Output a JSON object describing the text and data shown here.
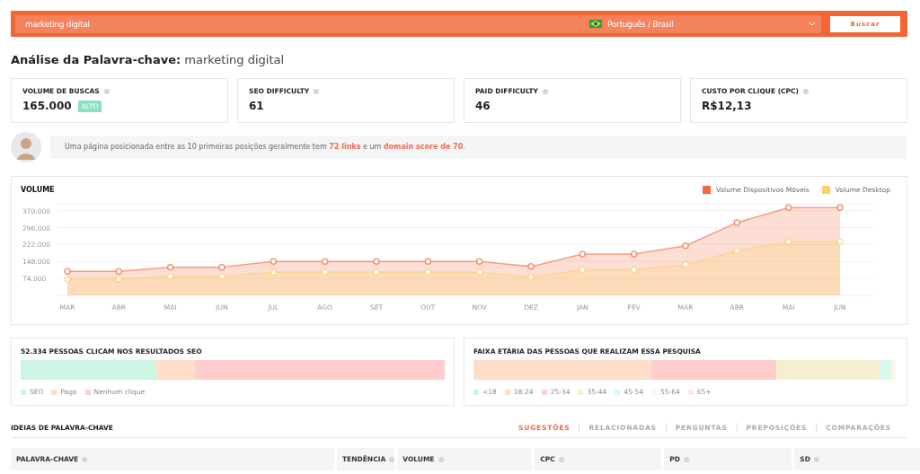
{
  "search": {
    "value": "marketing digital",
    "language": "Português / Brasil",
    "button": "Buscar"
  },
  "heading": {
    "label": "Análise da Palavra-chave:",
    "keyword": "marketing digital"
  },
  "metrics": [
    {
      "label": "VOLUME DE BUSCAS",
      "value": "165.000",
      "badge": "ALTO"
    },
    {
      "label": "SEO DIFFICULTY",
      "value": "61"
    },
    {
      "label": "PAID DIFFICULTY",
      "value": "46"
    },
    {
      "label": "CUSTO POR CLIQUE (CPC)",
      "value": "R$12,13"
    }
  ],
  "tip": "Uma página posicionada entre as 10 primeiras posições geralmente tem **72 links** e um **domain score de 70**.",
  "volume": {
    "title": "VOLUME",
    "chart_data": {
      "type": "area",
      "categories": [
        "MAR",
        "ABR",
        "MAI",
        "JUN",
        "JUL",
        "AGO",
        "SET",
        "OUT",
        "NOV",
        "DEZ",
        "JAN",
        "FEV",
        "MAR",
        "ABR",
        "MAI",
        "JUN"
      ],
      "series": [
        {
          "name": "Volume Dispositivos Móveis",
          "color": "#f26a3c",
          "values": [
            105000,
            105000,
            123000,
            123000,
            148000,
            148000,
            148000,
            148000,
            148000,
            126000,
            180000,
            180000,
            217000,
            318000,
            383000,
            383000
          ]
        },
        {
          "name": "Volume Desktop",
          "color": "#fdd06b",
          "values": [
            72000,
            72000,
            83000,
            83000,
            101000,
            101000,
            101000,
            101000,
            101000,
            79000,
            112000,
            112000,
            134000,
            195000,
            235000,
            235000
          ]
        }
      ],
      "grid": true,
      "ylim": [
        0,
        400000
      ],
      "yticks": [
        {
          "value": 74000,
          "label": "74.000"
        },
        {
          "value": 148000,
          "label": "148.000"
        },
        {
          "value": 222000,
          "label": "222.000"
        },
        {
          "value": 296000,
          "label": "296.000"
        },
        {
          "value": 370000,
          "label": "370.000"
        }
      ]
    }
  },
  "clicks": {
    "title": "52.334 PESSOAS CLICAM NOS RESULTADOS SEO",
    "segments": [
      {
        "label": "SEO",
        "color": "#cdf5e3"
      },
      {
        "label": "Pago",
        "color": "#ffdfc9"
      },
      {
        "label": "Nenhum clique",
        "color": "#ffcdcd"
      }
    ]
  },
  "ages": {
    "title": "FAIXA ETÁRIA DAS PESSOAS QUE REALIZAM ESSA PESQUISA",
    "segments": [
      {
        "label": "<18",
        "color": "#cdf5e3"
      },
      {
        "label": "18-24",
        "color": "#ffdfc9"
      },
      {
        "label": "25-34",
        "color": "#ffcdcd"
      },
      {
        "label": "35-44",
        "color": "#f7eed0"
      },
      {
        "label": "45-54",
        "color": "#dbfaef"
      },
      {
        "label": "55-64",
        "color": "#fff6e6"
      },
      {
        "label": "65+",
        "color": "#fde8e8"
      }
    ]
  },
  "ideas": {
    "title": "IDEIAS DE PALAVRA-CHAVE",
    "tabs": [
      {
        "label": "SUGESTÕES",
        "selected": true
      },
      {
        "label": "RELACIONADAS",
        "selected": false
      },
      {
        "label": "PERGUNTAS",
        "selected": false
      },
      {
        "label": "PREPOSIÇÕES",
        "selected": false
      },
      {
        "label": "COMPARAÇÕES",
        "selected": false
      }
    ],
    "columns": [
      "PALAVRA-CHAVE",
      "TENDÊNCIA",
      "VOLUME",
      "CPC",
      "PD",
      "SD"
    ]
  }
}
